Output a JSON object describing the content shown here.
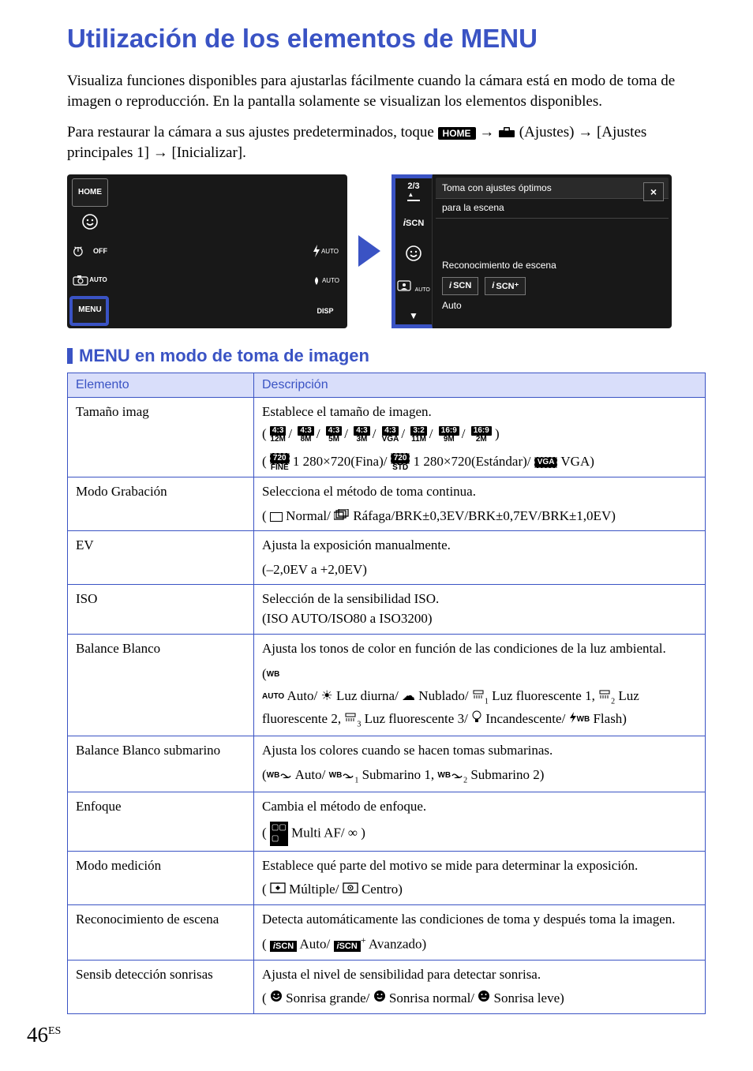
{
  "title": "Utilización de los elementos de MENU",
  "intro_p1": "Visualiza funciones disponibles para ajustarlas fácilmente cuando la cámara está en modo de toma de imagen o reproducción. En la pantalla solamente se visualizan los elementos disponibles.",
  "intro_p2_a": "Para restaurar la cámara a sus ajustes predeterminados, toque ",
  "intro_home": "HOME",
  "intro_p2_b": " (Ajustes) ",
  "intro_p2_c": "[Ajustes principales 1] ",
  "intro_p2_d": " [Inicializar].",
  "arrow": "→",
  "screen1": {
    "home": "HOME",
    "off": "OFF",
    "auto_side": "AUTO",
    "menu": "MENU",
    "flash_auto": "AUTO",
    "st_auto": "AUTO",
    "disp": "DISP"
  },
  "screen2": {
    "page": "2/3",
    "scn": "SCN",
    "auto_side": "AUTO",
    "down": "▼",
    "opt_title": "Toma con ajustes óptimos",
    "opt_title2": "para la escena",
    "rec_escena_label": "Reconocimiento de escena",
    "btn1": "SCN",
    "btn2": "SCN⁺",
    "auto_label": "Auto",
    "close": "×"
  },
  "subheading": "MENU en modo de toma de imagen",
  "table": {
    "col1": "Elemento",
    "col2": "Descripción",
    "rows": [
      {
        "elem": "Tamaño imag",
        "desc_line1": "Establece el tamaño de imagen.",
        "ratios": [
          {
            "top": "4:3",
            "bot": "12M"
          },
          {
            "top": "4:3",
            "bot": "8M"
          },
          {
            "top": "4:3",
            "bot": "5M"
          },
          {
            "top": "4:3",
            "bot": "3M"
          },
          {
            "top": "4:3",
            "bot": "VGA"
          },
          {
            "top": "3:2",
            "bot": "11M"
          },
          {
            "top": "16:9",
            "bot": "9M"
          },
          {
            "top": "16:9",
            "bot": "2M"
          }
        ],
        "video": {
          "fine_top": "720",
          "fine_bot": "FINE",
          "fine_txt": " 1 280×720(Fina)/",
          "std_top": "720",
          "std_bot": "STD",
          "std_txt": " 1 280×720(Estándar)/",
          "vga_label": "VGA",
          "vga_txt": " VGA)"
        }
      },
      {
        "elem": "Modo Grabación",
        "desc_line1": "Selecciona el método de toma continua.",
        "opts": "Normal/",
        "opts2": "Ráfaga/BRK±0,3EV/BRK±0,7EV/BRK±1,0EV)"
      },
      {
        "elem": "EV",
        "desc_line1": "Ajusta la exposición manualmente.",
        "opts": "(–2,0EV a +2,0EV)"
      },
      {
        "elem": "ISO",
        "desc_line1": "Selección de la sensibilidad ISO.",
        "desc_line2": "(ISO AUTO/ISO80 a ISO3200)"
      },
      {
        "elem": "Balance Blanco",
        "desc_line1": "Ajusta los tonos de color en función de las condiciones de la luz ambiental.",
        "wb_auto": "Auto/",
        "wb_day": " Luz diurna/",
        "wb_cloud": " Nublado/",
        "wb_f1": " Luz fluorescente 1, ",
        "wb_f2": " Luz fluorescente 2, ",
        "wb_f3": " Luz fluorescente 3/",
        "wb_inc": " Incandescente/",
        "wb_flash": " Flash)"
      },
      {
        "elem": "Balance Blanco submarino",
        "desc_line1": "Ajusta los colores cuando se hacen tomas submarinas.",
        "uw_auto": " Auto/",
        "uw_1": " Submarino 1, ",
        "uw_2": " Submarino 2)"
      },
      {
        "elem": "Enfoque",
        "desc_line1": "Cambia el método de enfoque.",
        "opts": " Multi AF/",
        "inf": "∞"
      },
      {
        "elem": "Modo medición",
        "desc_line1": "Establece qué parte del motivo se mide para determinar la exposición.",
        "m1": " Múltiple/",
        "m2": " Centro)"
      },
      {
        "elem": "Reconocimiento de escena",
        "desc_line1": "Detecta automáticamente las condiciones de toma y después toma la imagen.",
        "r1": " Auto/",
        "r2": " Avanzado)"
      },
      {
        "elem": "Sensib detección sonrisas",
        "desc_line1": "Ajusta el nivel de sensibilidad para detectar sonrisa.",
        "s1": " Sonrisa grande/",
        "s2": " Sonrisa normal/",
        "s3": " Sonrisa leve)"
      }
    ]
  },
  "page_num": "46",
  "page_lang": "ES"
}
